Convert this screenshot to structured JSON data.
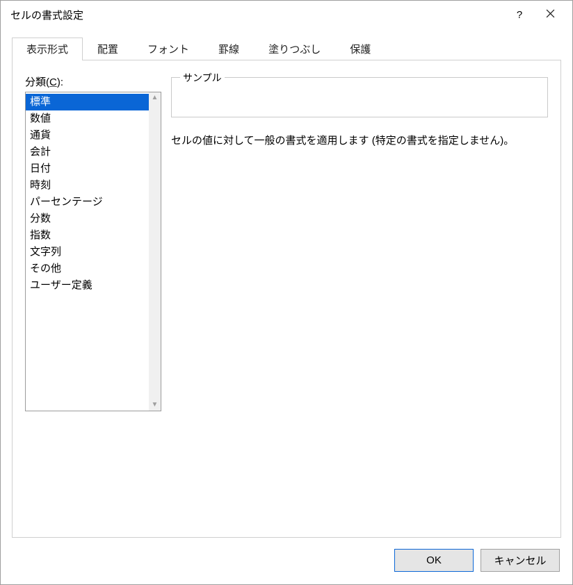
{
  "dialog": {
    "title": "セルの書式設定",
    "help_symbol": "?",
    "close_aria": "閉じる"
  },
  "tabs": {
    "items": [
      {
        "label": "表示形式",
        "active": true
      },
      {
        "label": "配置",
        "active": false
      },
      {
        "label": "フォント",
        "active": false
      },
      {
        "label": "罫線",
        "active": false
      },
      {
        "label": "塗りつぶし",
        "active": false
      },
      {
        "label": "保護",
        "active": false
      }
    ]
  },
  "category": {
    "label_prefix": "分類(",
    "label_mnemonic": "C",
    "label_suffix": "):",
    "items": [
      {
        "label": "標準",
        "selected": true
      },
      {
        "label": "数値",
        "selected": false
      },
      {
        "label": "通貨",
        "selected": false
      },
      {
        "label": "会計",
        "selected": false
      },
      {
        "label": "日付",
        "selected": false
      },
      {
        "label": "時刻",
        "selected": false
      },
      {
        "label": "パーセンテージ",
        "selected": false
      },
      {
        "label": "分数",
        "selected": false
      },
      {
        "label": "指数",
        "selected": false
      },
      {
        "label": "文字列",
        "selected": false
      },
      {
        "label": "その他",
        "selected": false
      },
      {
        "label": "ユーザー定義",
        "selected": false
      }
    ]
  },
  "sample": {
    "caption": "サンプル",
    "value": ""
  },
  "description": "セルの値に対して一般の書式を適用します (特定の書式を指定しません)。",
  "buttons": {
    "ok": "OK",
    "cancel": "キャンセル"
  }
}
